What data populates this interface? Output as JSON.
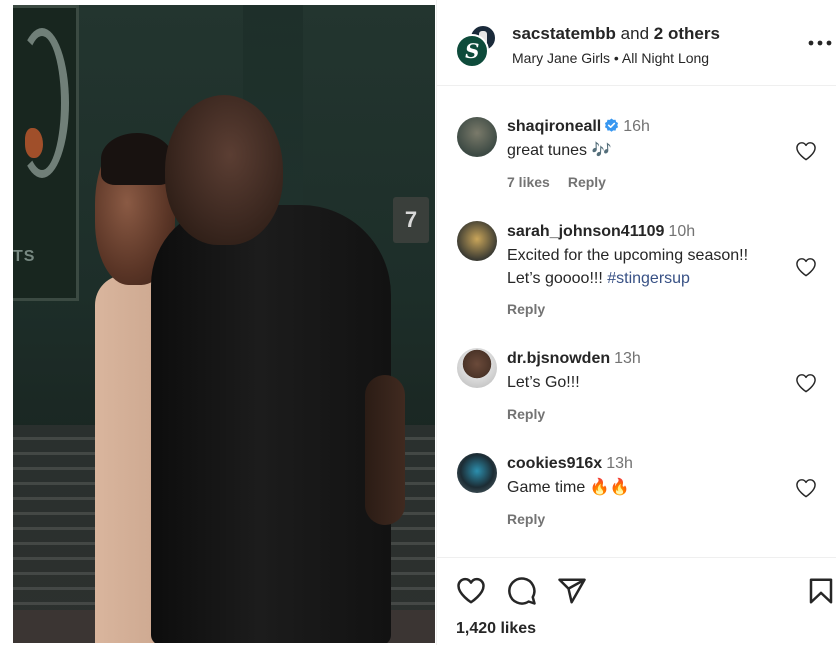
{
  "post": {
    "header": {
      "username": "sacstatembb",
      "joiner": "and",
      "others": "2 others",
      "song": "Mary Jane Girls • All Night Long",
      "more_icon": "more-horizontal-icon"
    },
    "photo_sign": "7",
    "banner_text": "TS"
  },
  "comments": [
    {
      "username": "shaqironeall",
      "verified": true,
      "time": "16h",
      "text": "great tunes 🎶",
      "likes": "7 likes",
      "reply": "Reply"
    },
    {
      "username": "sarah_johnson41109",
      "time": "10h",
      "text_line1": "Excited for the upcoming season!!",
      "text_line2": "Let’s goooo!!! ",
      "hashtag": "#stingersup",
      "reply": "Reply"
    },
    {
      "username": "dr.bjsnowden",
      "time": "13h",
      "text": "Let’s Go!!!",
      "reply": "Reply"
    },
    {
      "username": "cookies916x",
      "time": "13h",
      "text": "Game time 🔥🔥",
      "reply": "Reply"
    }
  ],
  "actions": {
    "like_icon": "heart-icon",
    "comment_icon": "comment-icon",
    "share_icon": "share-icon",
    "save_icon": "bookmark-icon",
    "likes_count": "1,420 likes"
  },
  "colors": {
    "verified": "#3897f0",
    "hashtag": "#385185",
    "muted": "#737373"
  }
}
